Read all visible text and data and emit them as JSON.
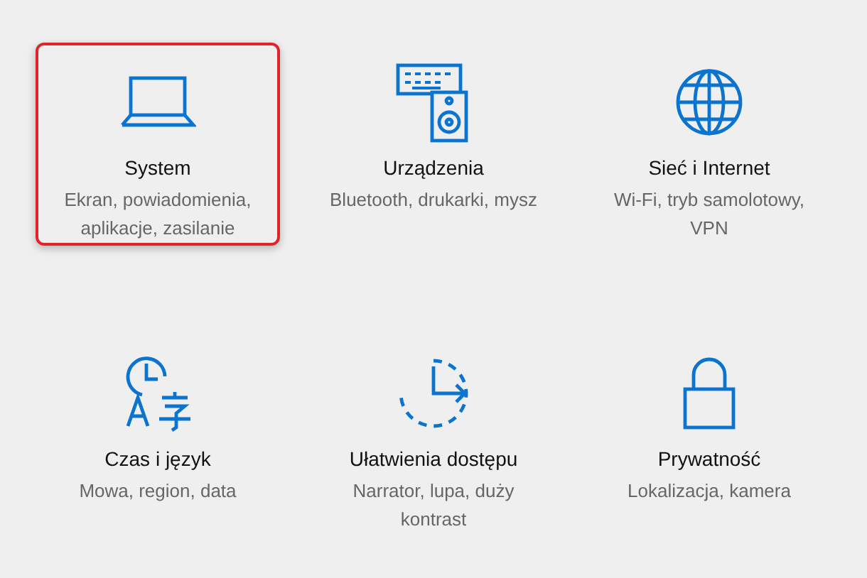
{
  "tiles": [
    {
      "title": "System",
      "description": "Ekran, powiadomienia, aplikacje, zasilanie",
      "selected": true
    },
    {
      "title": "Urządzenia",
      "description": "Bluetooth, drukarki, mysz",
      "selected": false
    },
    {
      "title": "Sieć i Internet",
      "description": "Wi-Fi, tryb samolotowy, VPN",
      "selected": false
    },
    {
      "title": "Czas i język",
      "description": "Mowa, region, data",
      "selected": false
    },
    {
      "title": "Ułatwienia dostępu",
      "description": "Narrator, lupa, duży kontrast",
      "selected": false
    },
    {
      "title": "Prywatność",
      "description": "Lokalizacja, kamera",
      "selected": false
    }
  ]
}
